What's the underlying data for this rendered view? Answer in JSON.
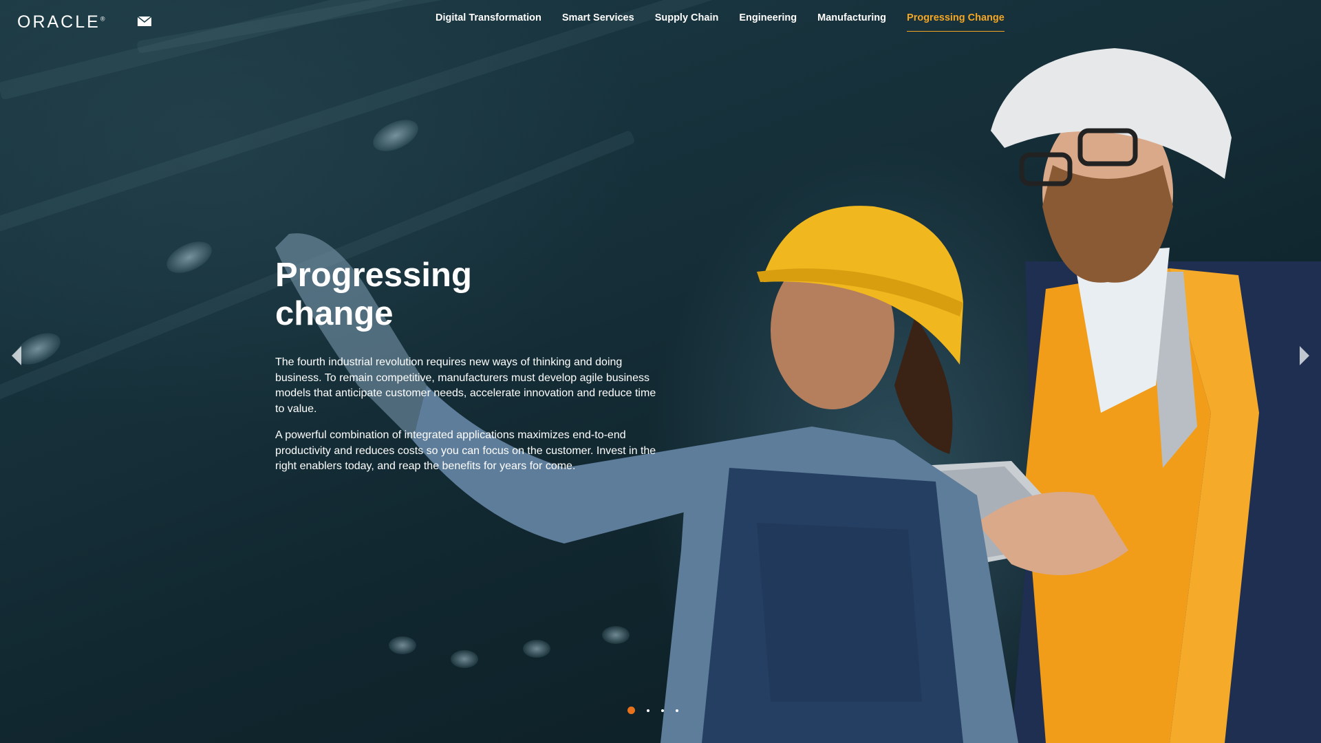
{
  "header": {
    "logo_text": "ORACLE",
    "logo_mark": "®",
    "mail_icon": "mail-icon"
  },
  "nav": {
    "items": [
      {
        "label": "Digital Transformation",
        "active": false
      },
      {
        "label": "Smart Services",
        "active": false
      },
      {
        "label": "Supply Chain",
        "active": false
      },
      {
        "label": "Engineering",
        "active": false
      },
      {
        "label": "Manufacturing",
        "active": false
      },
      {
        "label": "Progressing Change",
        "active": true
      }
    ],
    "active_color": "#f5a623"
  },
  "hero": {
    "title_line1": "Progressing",
    "title_line2": "change",
    "paragraph1": "The fourth industrial revolution requires new ways of thinking and doing business. To remain competitive, manufacturers must develop agile business models that anticipate customer needs, accelerate innovation and reduce time to value.",
    "paragraph2": "A powerful combination of integrated applications maximizes end-to-end productivity and reduces costs so you can focus on the customer. Invest in the right enablers today, and reap the benefits for years for come."
  },
  "carousel": {
    "prev_icon": "chevron-left-icon",
    "next_icon": "chevron-right-icon",
    "slide_count": 4,
    "active_slide": 1,
    "active_dot_color": "#e8721c"
  }
}
